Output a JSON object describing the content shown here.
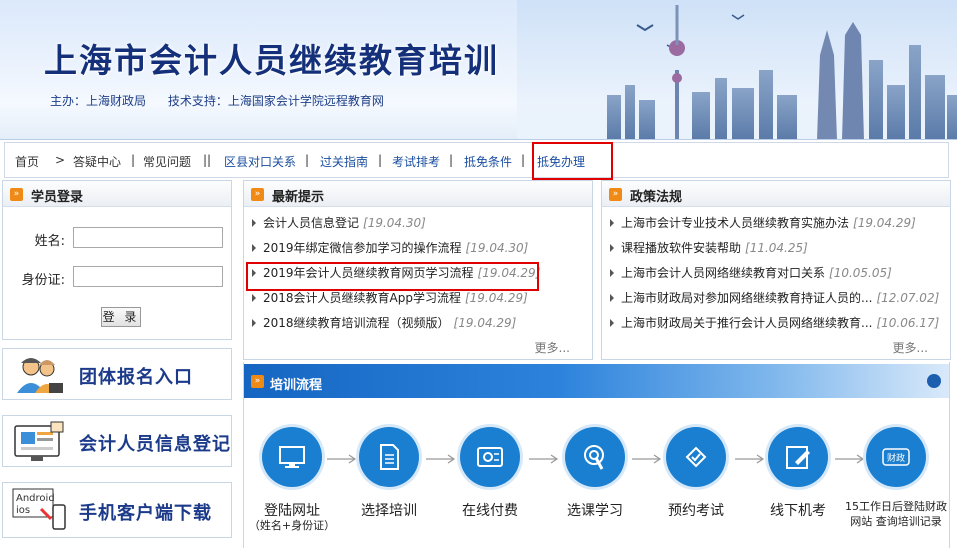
{
  "banner": {
    "title": "上海市会计人员继续教育培训",
    "organizer": "主办：上海财政局",
    "tech_support": "技术支持：上海国家会计学院远程教育网"
  },
  "nav": {
    "items": [
      {
        "label": "首页"
      },
      {
        "label": ">"
      },
      {
        "label": "答疑中心"
      },
      {
        "label": "常见问题"
      },
      {
        "label": "区县对口关系"
      },
      {
        "label": "过关指南"
      },
      {
        "label": "考试排考"
      },
      {
        "label": "抵免条件"
      },
      {
        "label": "抵免办理"
      }
    ],
    "separators": [
      "|",
      "||",
      "|",
      "|",
      "|",
      "|"
    ]
  },
  "login": {
    "title": "学员登录",
    "name_label": "姓名:",
    "id_label": "身份证:",
    "submit_label": "登 录"
  },
  "latest": {
    "title": "最新提示",
    "items": [
      {
        "text": "会计人员信息登记",
        "date": "[19.04.30]"
      },
      {
        "text": "2019年绑定微信参加学习的操作流程",
        "date": "[19.04.30]"
      },
      {
        "text": "2019年会计人员继续教育网页学习流程",
        "date": "[19.04.29]"
      },
      {
        "text": "2018会计人员继续教育App学习流程",
        "date": "[19.04.29]"
      },
      {
        "text": "2018继续教育培训流程（视频版）",
        "date": "[19.04.29]"
      }
    ],
    "more": "更多..."
  },
  "policy": {
    "title": "政策法规",
    "items": [
      {
        "text": "上海市会计专业技术人员继续教育实施办法",
        "date": "[19.04.29]"
      },
      {
        "text": "课程播放软件安装帮助",
        "date": "[11.04.25]"
      },
      {
        "text": "上海市会计人员网络继续教育对口关系",
        "date": "[10.05.05]"
      },
      {
        "text": "上海市财政局对参加网络继续教育持证人员的...",
        "date": "[12.07.02]"
      },
      {
        "text": "上海市财政局关于推行会计人员网络继续教育...",
        "date": "[10.06.17]"
      }
    ],
    "more": "更多..."
  },
  "quicklinks": {
    "group": "团体报名入口",
    "register": "会计人员信息登记",
    "mobile": "手机客户端下载",
    "mobile_icon_text1": "Android",
    "mobile_icon_text2": "ios"
  },
  "process": {
    "title": "培训流程",
    "steps": [
      {
        "label": "登陆网址",
        "sub": "（姓名+身份证）",
        "icon": "monitor-icon"
      },
      {
        "label": "选择培训",
        "sub": "",
        "icon": "document-icon"
      },
      {
        "label": "在线付费",
        "sub": "",
        "icon": "payment-icon"
      },
      {
        "label": "选课学习",
        "sub": "",
        "icon": "touch-icon"
      },
      {
        "label": "预约考试",
        "sub": "",
        "icon": "checklist-icon"
      },
      {
        "label": "线下机考",
        "sub": "",
        "icon": "pen-icon"
      },
      {
        "label": "15工作日后登陆财政网站 查询培训记录",
        "sub": "",
        "icon": "finance-icon",
        "icon_text": "财政"
      }
    ]
  },
  "colors": {
    "title_blue": "#14307a",
    "link_blue": "#1a4ea0",
    "highlight_red": "#e00000",
    "accent_orange": "#f08a16",
    "step_blue": "#1a7fd0"
  }
}
